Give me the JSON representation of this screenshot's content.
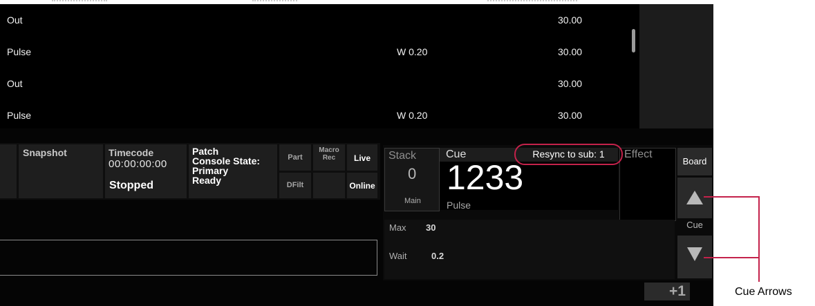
{
  "cue_list": {
    "rows": [
      {
        "label": "Out",
        "mid": "",
        "time": "30.00"
      },
      {
        "label": "Pulse",
        "mid": "W 0.20",
        "time": "30.00"
      },
      {
        "label": "Out",
        "mid": "",
        "time": "30.00"
      },
      {
        "label": "Pulse",
        "mid": "W 0.20",
        "time": "30.00"
      }
    ]
  },
  "status": {
    "snapshot": "Snapshot",
    "timecode_label": "Timecode",
    "timecode_value": "00:00:00:00",
    "timecode_state": "Stopped",
    "patch": "Patch",
    "console_state_label": "Console State:",
    "console_state_line1": "Primary",
    "console_state_line2": "Ready",
    "part": "Part",
    "macro_rec": "Macro Rec",
    "live": "Live",
    "dfilt": "DFilt",
    "online": "Online"
  },
  "playback": {
    "stack_label": "Stack",
    "stack_value": "0",
    "stack_sub": "Main",
    "cue_label": "Cue",
    "cue_number": "1233",
    "cue_name": "Pulse",
    "effect_label": "Effect",
    "max_label": "Max",
    "max_value": "30",
    "wait_label": "Wait",
    "wait_value": "0.2",
    "resync": "Resync to sub: 1"
  },
  "board": {
    "board_label": "Board",
    "cue_label": "Cue",
    "plus_one": "+1"
  },
  "annotation": {
    "label": "Cue Arrows",
    "color": "#c4224b"
  }
}
